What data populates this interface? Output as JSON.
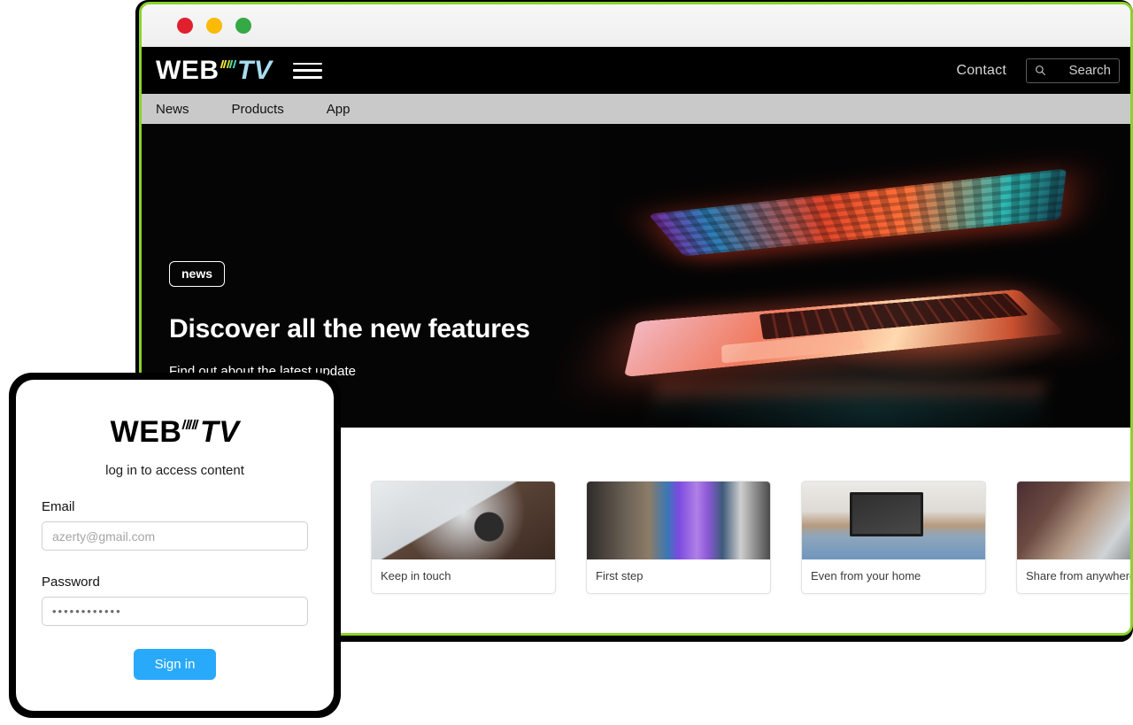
{
  "window": {
    "traffic_lights": [
      {
        "name": "close",
        "color": "#E0202F"
      },
      {
        "name": "minimize",
        "color": "#FBBA05"
      },
      {
        "name": "maximize",
        "color": "#36A947"
      }
    ],
    "border_color": "#8BD22B"
  },
  "site": {
    "logo": {
      "web": "WEB",
      "tv": "TV",
      "tick_colors": [
        "#F2E33A",
        "#F2E33A",
        "#BFE33A",
        "#6FD88C",
        "#3ED8C6"
      ]
    },
    "header": {
      "menu_icon": "hamburger-icon",
      "contact_label": "Contact",
      "search": {
        "icon": "search-icon",
        "label": "Search",
        "placeholder": "Search"
      }
    },
    "nav": [
      {
        "label": "News"
      },
      {
        "label": "Products"
      },
      {
        "label": "App"
      }
    ],
    "hero": {
      "badge": "news",
      "title": "Discover all the new features",
      "subtitle": "Find out about the latest update",
      "image_alt": "glowing-laptop-photo"
    },
    "cards": [
      {
        "label": "",
        "image": "img-fire"
      },
      {
        "label": "Keep in touch",
        "image": "img-watch"
      },
      {
        "label": "First step",
        "image": "img-phone"
      },
      {
        "label": "Even from your home",
        "image": "img-home"
      },
      {
        "label": "Share from anywhere",
        "image": "img-share"
      }
    ]
  },
  "login": {
    "logo": {
      "web": "WEB",
      "tv": "TV"
    },
    "subtitle": "log in to access content",
    "email": {
      "label": "Email",
      "value": "",
      "placeholder": "azerty@gmail.com"
    },
    "password": {
      "label": "Password",
      "value": "••••••••••••",
      "placeholder": ""
    },
    "submit_label": "Sign in",
    "accent_color": "#29A9FA"
  }
}
